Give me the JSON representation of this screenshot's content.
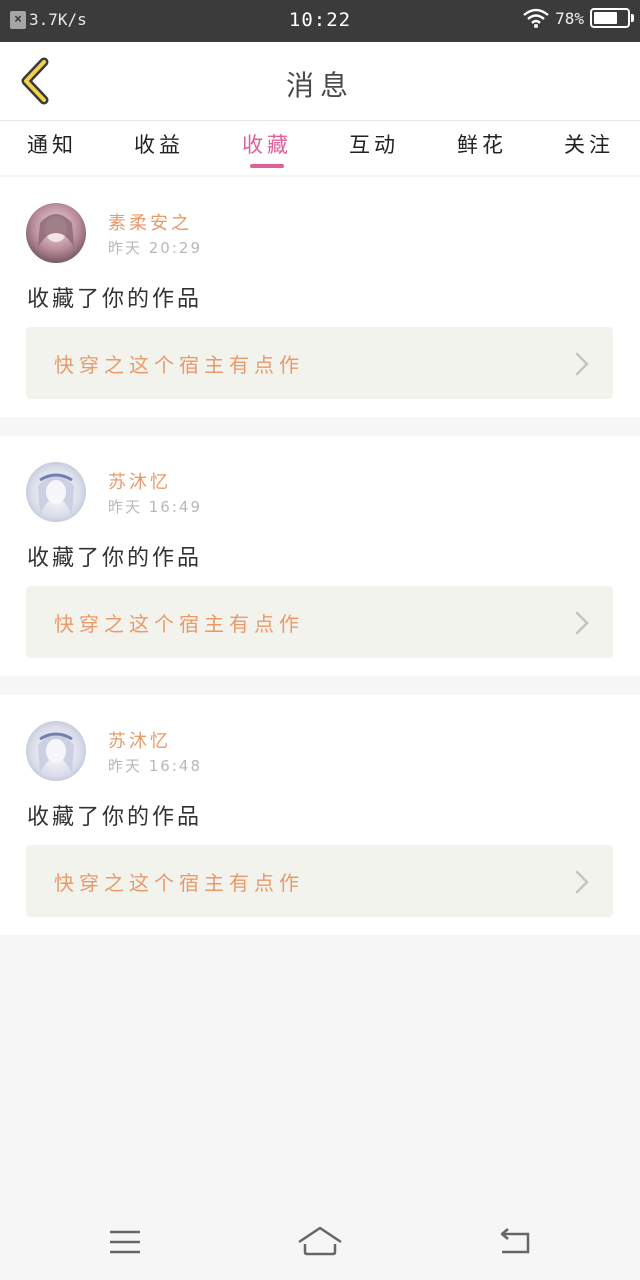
{
  "status_bar": {
    "net_speed": "3.7K/s",
    "time": "10:22",
    "battery_percent": "78%",
    "battery_level": 0.78,
    "icons": [
      "notification-x-icon",
      "wifi-icon",
      "battery-icon"
    ]
  },
  "header": {
    "title": "消息",
    "back_icon": "chevron-left-icon"
  },
  "tabs": [
    {
      "label": "通知"
    },
    {
      "label": "收益"
    },
    {
      "label": "收藏"
    },
    {
      "label": "互动"
    },
    {
      "label": "鲜花"
    },
    {
      "label": "关注"
    }
  ],
  "active_tab": "收藏",
  "accent_color": "#e0609a",
  "username_color": "#e89a6a",
  "messages": [
    {
      "user": "素柔安之",
      "time": "昨天 20:29",
      "action": "收藏了你的作品",
      "work_title": "快穿之这个宿主有点作"
    },
    {
      "user": "苏沐忆",
      "time": "昨天 16:49",
      "action": "收藏了你的作品",
      "work_title": "快穿之这个宿主有点作"
    },
    {
      "user": "苏沐忆",
      "time": "昨天 16:48",
      "action": "收藏了你的作品",
      "work_title": "快穿之这个宿主有点作"
    }
  ],
  "bottom_nav": {
    "icons": [
      "menu-icon",
      "home-icon",
      "back-icon"
    ]
  }
}
